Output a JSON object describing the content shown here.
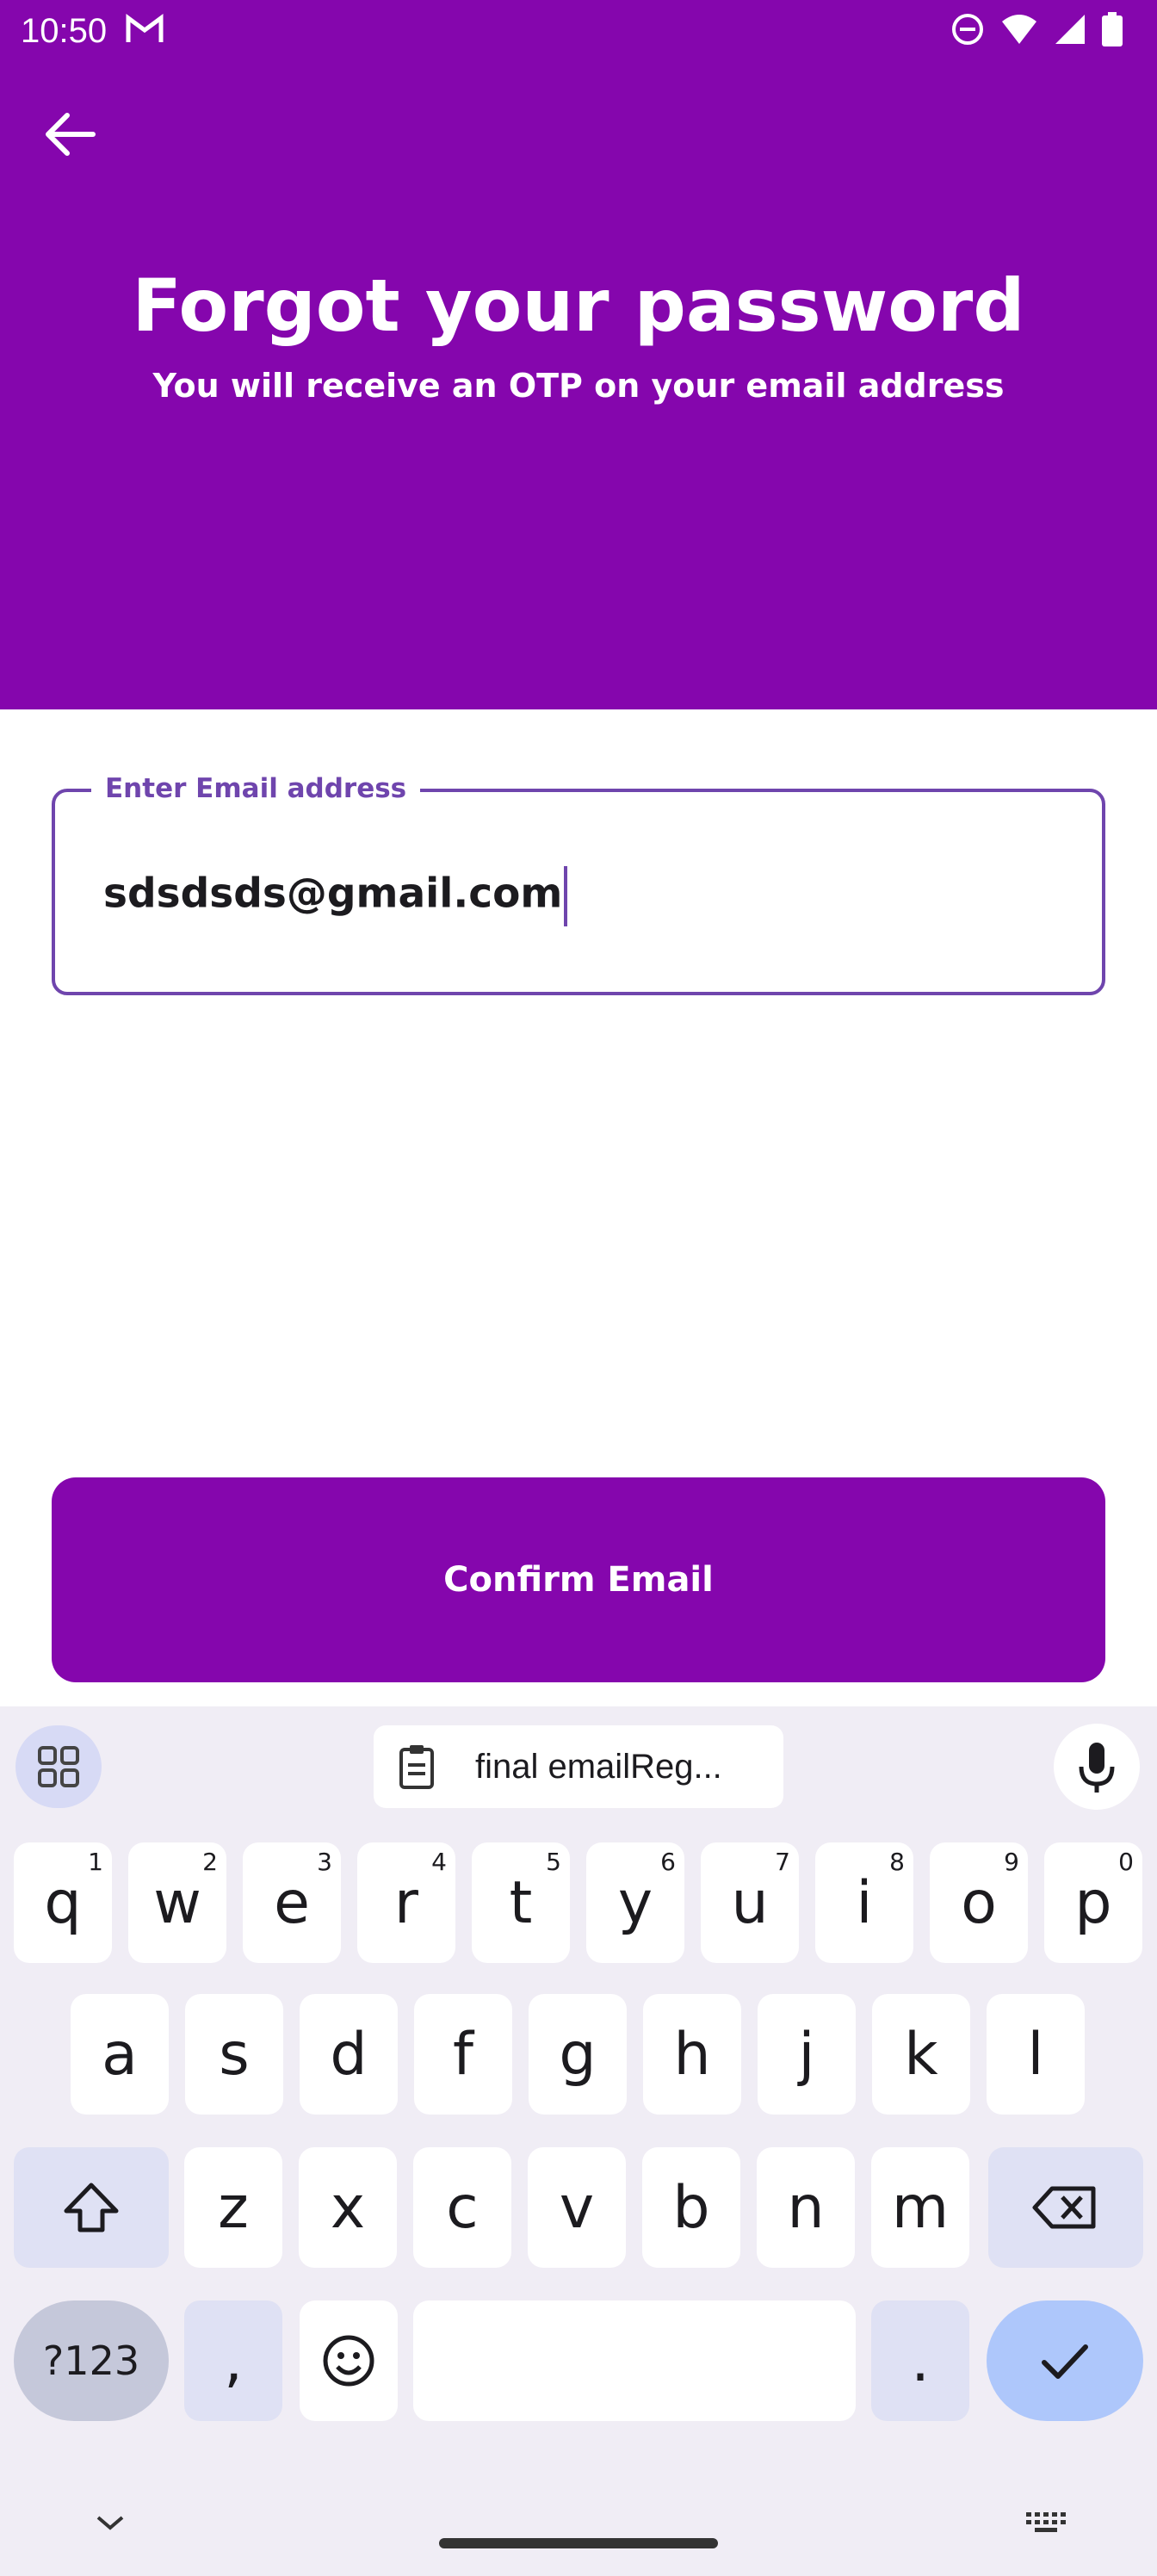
{
  "status_bar": {
    "time": "10:50"
  },
  "header": {
    "title": "Forgot your password",
    "subtitle": "You will receive an OTP on your email address"
  },
  "email_field": {
    "label": "Enter Email address",
    "value": "sdsdsds@gmail.com"
  },
  "confirm_button": {
    "label": "Confirm Email"
  },
  "keyboard": {
    "clipboard_suggestion": "final emailReg...",
    "row1": [
      {
        "k": "q",
        "n": "1"
      },
      {
        "k": "w",
        "n": "2"
      },
      {
        "k": "e",
        "n": "3"
      },
      {
        "k": "r",
        "n": "4"
      },
      {
        "k": "t",
        "n": "5"
      },
      {
        "k": "y",
        "n": "6"
      },
      {
        "k": "u",
        "n": "7"
      },
      {
        "k": "i",
        "n": "8"
      },
      {
        "k": "o",
        "n": "9"
      },
      {
        "k": "p",
        "n": "0"
      }
    ],
    "row2": [
      "a",
      "s",
      "d",
      "f",
      "g",
      "h",
      "j",
      "k",
      "l"
    ],
    "row3": [
      "z",
      "x",
      "c",
      "v",
      "b",
      "n",
      "m"
    ],
    "symbols_key": "?123",
    "comma_key": ",",
    "period_key": "."
  },
  "colors": {
    "brand": "#8506ad",
    "field_border": "#6f45ad"
  }
}
